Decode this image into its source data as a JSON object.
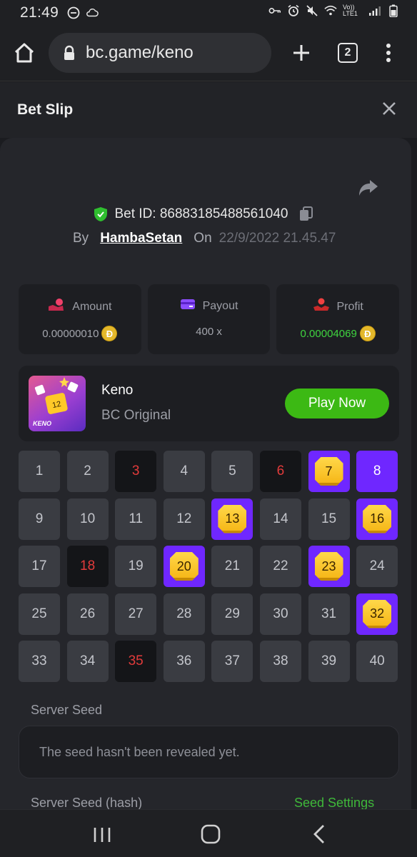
{
  "status_bar": {
    "time": "21:49",
    "network_label": "Vo)) LTE1"
  },
  "browser": {
    "url": "bc.game/keno",
    "tab_count": "2"
  },
  "header": {
    "title": "Bet Slip"
  },
  "bet": {
    "bet_id_label": "Bet ID:",
    "bet_id": "86883185488561040",
    "by_label": "By",
    "user": "HambaSetan",
    "on_label": "On",
    "date": "22/9/2022 21.45.47"
  },
  "stats": {
    "amount_label": "Amount",
    "amount_value": "0.00000010",
    "payout_label": "Payout",
    "payout_value": "400 x",
    "profit_label": "Profit",
    "profit_value": "0.00004069",
    "coin_symbol": "Đ"
  },
  "game": {
    "thumb_text": "KENO",
    "thumb_tile": "12",
    "name": "Keno",
    "subtitle": "BC Original",
    "play_label": "Play Now"
  },
  "grid": {
    "cells": [
      {
        "n": "1",
        "state": "normal"
      },
      {
        "n": "2",
        "state": "normal"
      },
      {
        "n": "3",
        "state": "miss"
      },
      {
        "n": "4",
        "state": "normal"
      },
      {
        "n": "5",
        "state": "normal"
      },
      {
        "n": "6",
        "state": "miss"
      },
      {
        "n": "7",
        "state": "match"
      },
      {
        "n": "8",
        "state": "picked"
      },
      {
        "n": "9",
        "state": "normal"
      },
      {
        "n": "10",
        "state": "normal"
      },
      {
        "n": "11",
        "state": "normal"
      },
      {
        "n": "12",
        "state": "normal"
      },
      {
        "n": "13",
        "state": "match"
      },
      {
        "n": "14",
        "state": "normal"
      },
      {
        "n": "15",
        "state": "normal"
      },
      {
        "n": "16",
        "state": "match"
      },
      {
        "n": "17",
        "state": "normal"
      },
      {
        "n": "18",
        "state": "miss"
      },
      {
        "n": "19",
        "state": "normal"
      },
      {
        "n": "20",
        "state": "match"
      },
      {
        "n": "21",
        "state": "normal"
      },
      {
        "n": "22",
        "state": "normal"
      },
      {
        "n": "23",
        "state": "match"
      },
      {
        "n": "24",
        "state": "normal"
      },
      {
        "n": "25",
        "state": "normal"
      },
      {
        "n": "26",
        "state": "normal"
      },
      {
        "n": "27",
        "state": "normal"
      },
      {
        "n": "28",
        "state": "normal"
      },
      {
        "n": "29",
        "state": "normal"
      },
      {
        "n": "30",
        "state": "normal"
      },
      {
        "n": "31",
        "state": "normal"
      },
      {
        "n": "32",
        "state": "match"
      },
      {
        "n": "33",
        "state": "normal"
      },
      {
        "n": "34",
        "state": "normal"
      },
      {
        "n": "35",
        "state": "miss"
      },
      {
        "n": "36",
        "state": "normal"
      },
      {
        "n": "37",
        "state": "normal"
      },
      {
        "n": "38",
        "state": "normal"
      },
      {
        "n": "39",
        "state": "normal"
      },
      {
        "n": "40",
        "state": "normal"
      }
    ]
  },
  "seed": {
    "server_seed_label": "Server Seed",
    "server_seed_text": "The seed hasn't been revealed yet.",
    "hash_label": "Server Seed (hash)",
    "settings_link": "Seed Settings"
  },
  "colors": {
    "accent_purple": "#6f27ff",
    "gem_yellow": "#ffd84a",
    "play_green": "#3cb914",
    "profit_green": "#3fd43f",
    "miss_red": "#e23b3b"
  }
}
